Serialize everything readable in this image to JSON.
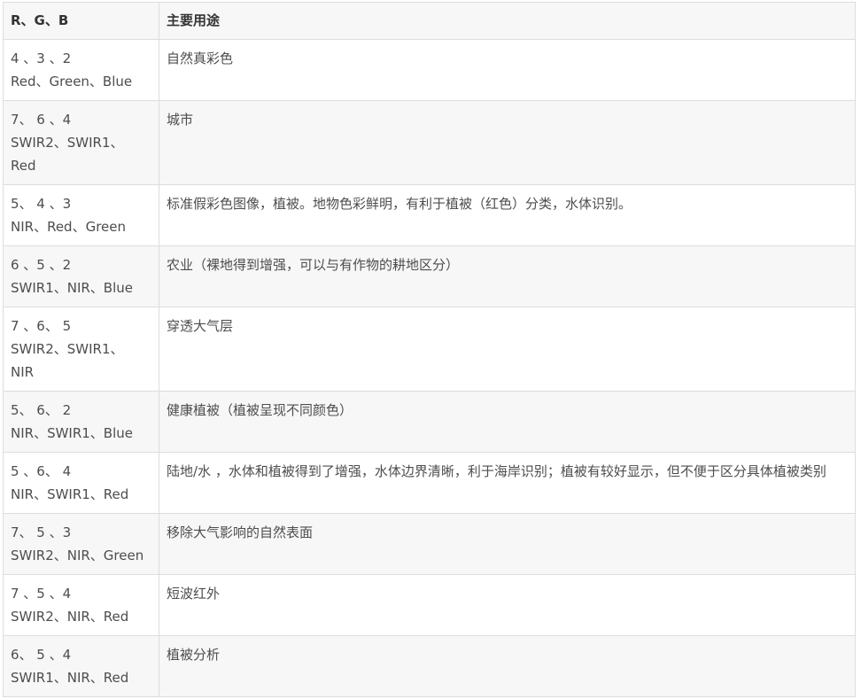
{
  "table": {
    "headers": [
      "R、G、B",
      "主要用途"
    ],
    "rows": [
      {
        "combo": "4 、3 、2",
        "bands": "Red、Green、Blue",
        "bands2": "",
        "usage": "自然真彩色"
      },
      {
        "combo": "7、 6 、4",
        "bands": "SWIR2、SWIR1、",
        "bands2": "Red",
        "usage": "城市"
      },
      {
        "combo": "5、 4 、3",
        "bands": "NIR、Red、Green",
        "bands2": "",
        "usage": "标准假彩色图像，植被。地物色彩鲜明，有利于植被（红色）分类，水体识别。"
      },
      {
        "combo": "6 、5 、2",
        "bands": "SWIR1、NIR、Blue",
        "bands2": "",
        "usage": "农业（裸地得到增强，可以与有作物的耕地区分）"
      },
      {
        "combo": "7 、6、 5",
        "bands": "SWIR2、SWIR1、",
        "bands2": "NIR",
        "usage": "穿透大气层"
      },
      {
        "combo": "5、 6、 2",
        "bands": "NIR、SWIR1、Blue",
        "bands2": "",
        "usage": "健康植被（植被呈现不同颜色）"
      },
      {
        "combo": "5 、6、 4",
        "bands": "NIR、SWIR1、Red",
        "bands2": "",
        "usage": "陆地/水 ，水体和植被得到了增强，水体边界清晰，利于海岸识别；植被有较好显示，但不便于区分具体植被类别"
      },
      {
        "combo": "7、 5 、3",
        "bands": "SWIR2、NIR、Green",
        "bands2": "",
        "usage": "移除大气影响的自然表面"
      },
      {
        "combo": "7 、5 、4",
        "bands": "SWIR2、NIR、Red",
        "bands2": "",
        "usage": "短波红外"
      },
      {
        "combo": "6、 5 、4",
        "bands": "SWIR1、NIR、Red",
        "bands2": "",
        "usage": "植被分析"
      }
    ]
  }
}
